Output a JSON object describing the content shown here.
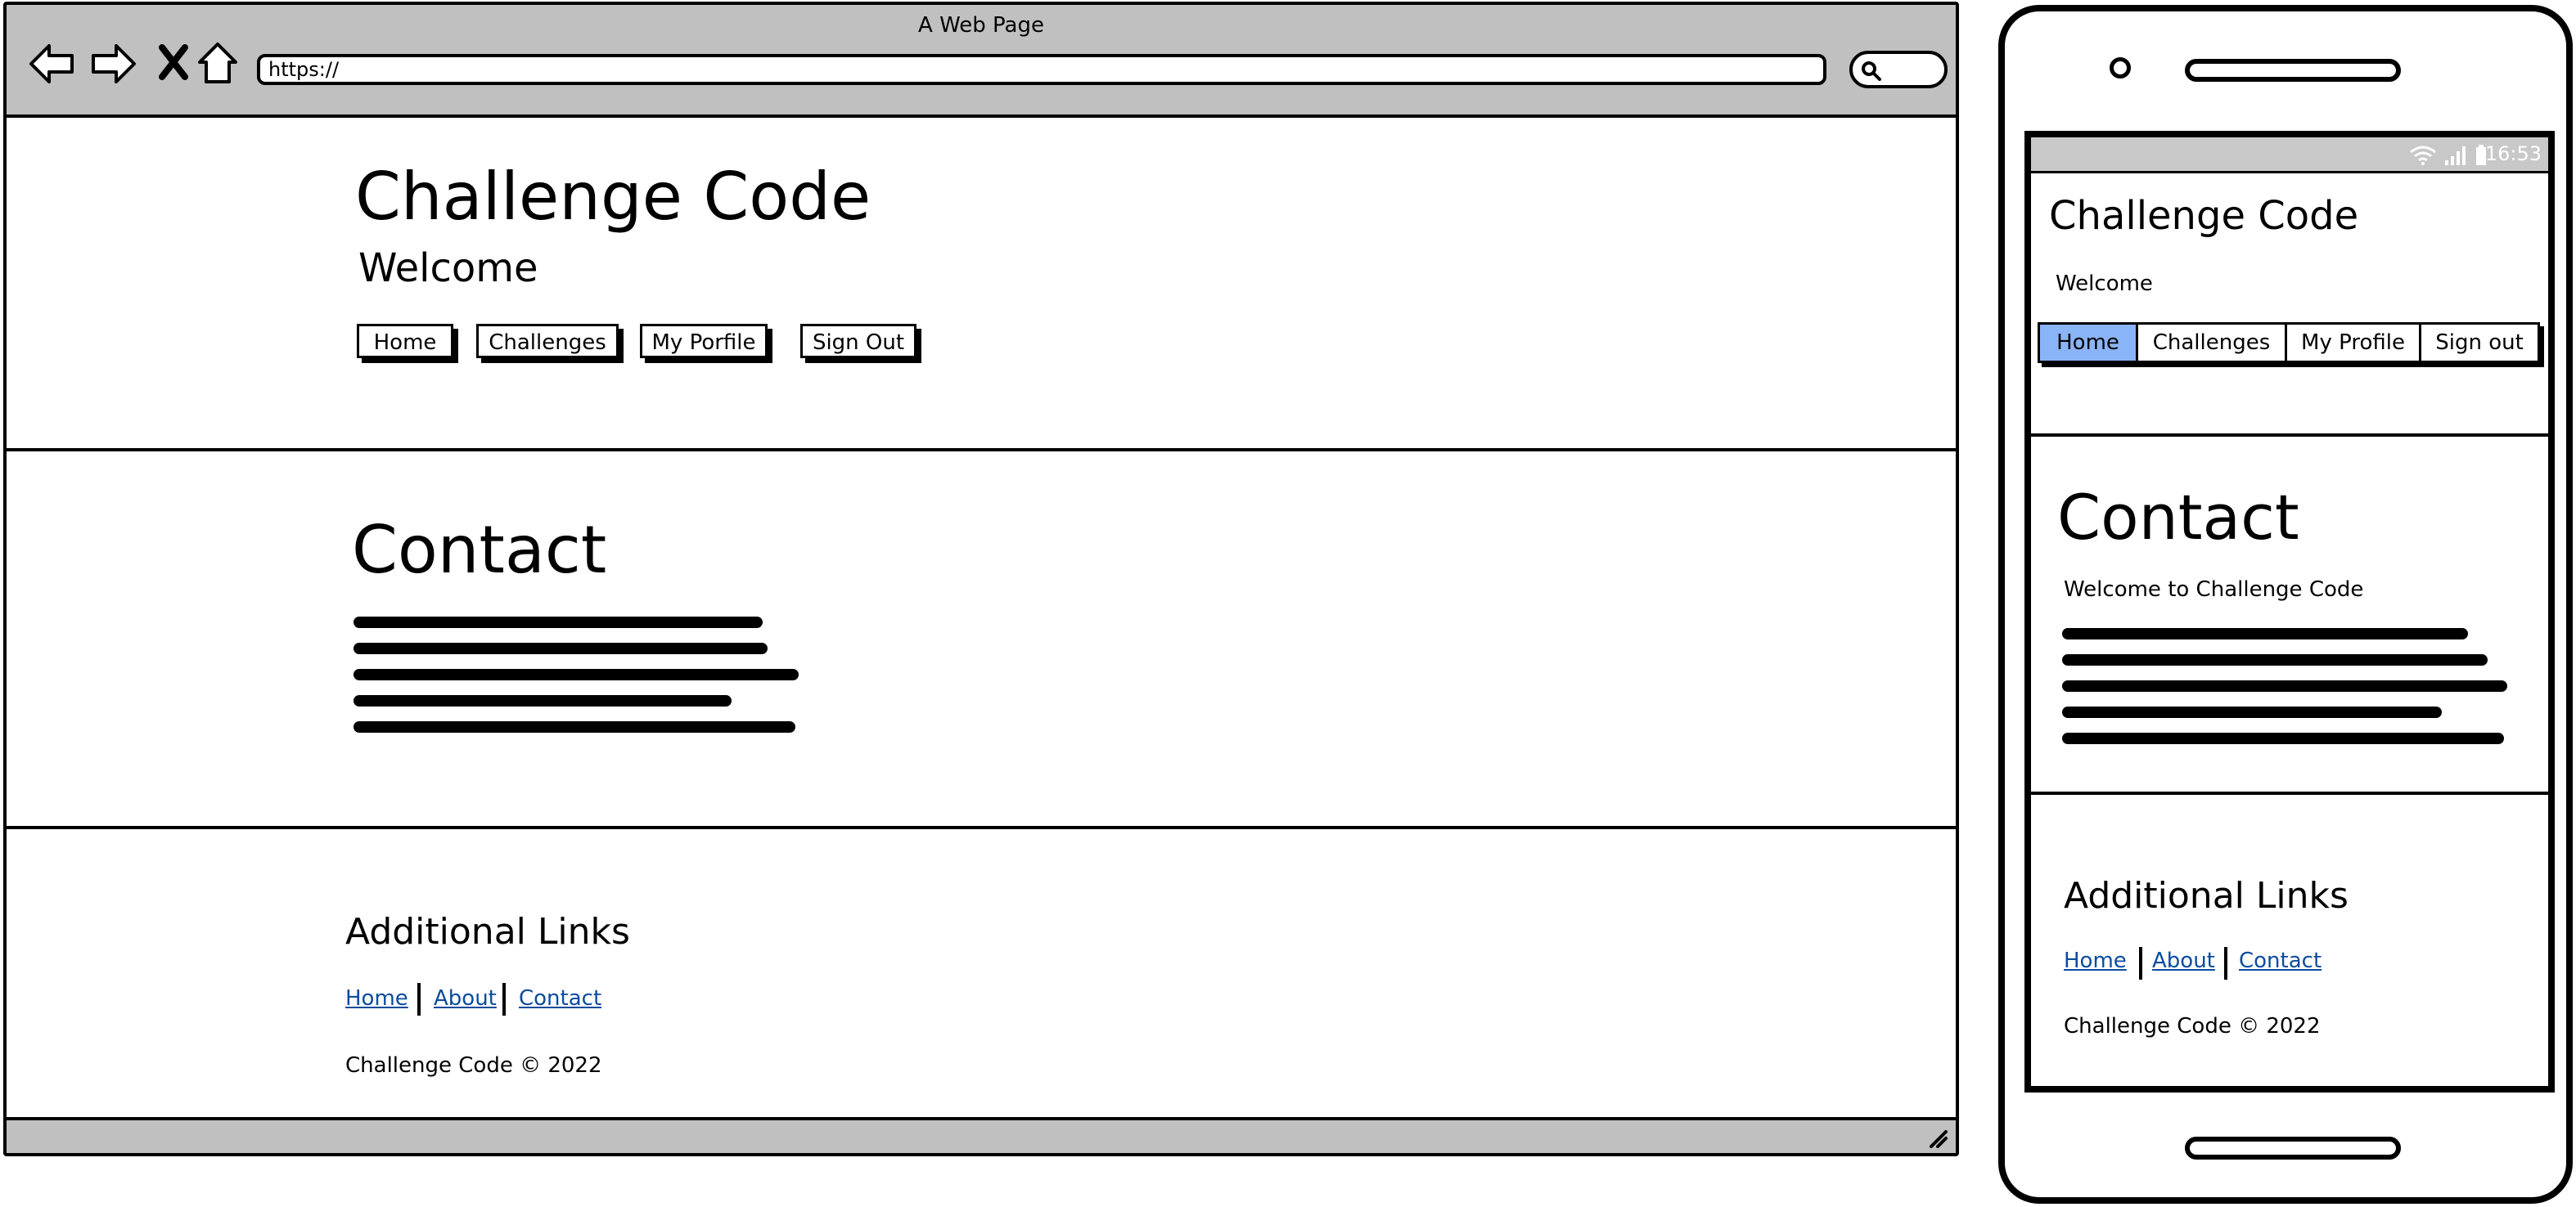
{
  "browser": {
    "window_title": "A Web Page",
    "url": "https://",
    "icons": [
      "back-arrow-icon",
      "forward-arrow-icon",
      "close-x-icon",
      "home-icon",
      "search-icon",
      "resize-grip-icon"
    ]
  },
  "header": {
    "title": "Challenge Code",
    "subtitle": "Welcome",
    "nav": [
      "Home",
      "Challenges",
      "My Porfile",
      "Sign Out"
    ]
  },
  "contact": {
    "heading": "Contact"
  },
  "footer": {
    "heading": "Additional Links",
    "links": [
      "Home",
      "About",
      "Contact"
    ],
    "copyright": "Challenge Code © 2022"
  },
  "phone": {
    "status_time": "16:53",
    "title": "Challenge Code",
    "subtitle": "Welcome",
    "tabs": [
      "Home",
      "Challenges",
      "My Profile",
      "Sign out"
    ],
    "active_tab": "Home",
    "contact_heading": "Contact",
    "contact_intro": "Welcome to Challenge Code",
    "footer_heading": "Additional Links",
    "footer_links": [
      "Home",
      "About",
      "Contact"
    ],
    "copyright": "Challenge Code © 2022"
  },
  "colors": {
    "chrome_gray": "#c0c0c0",
    "link_blue": "#0b4b9e",
    "active_tab": "#8ab4f8"
  }
}
